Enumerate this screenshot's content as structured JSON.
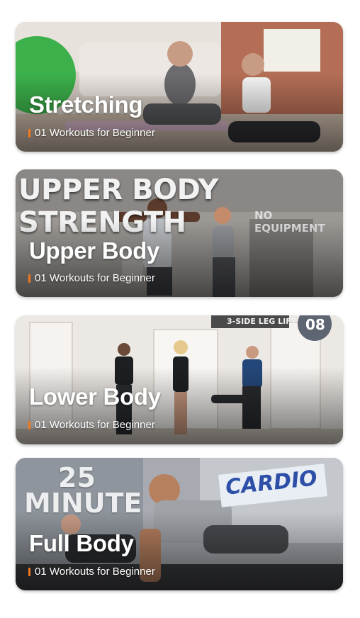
{
  "workouts": [
    {
      "title": "Stretching",
      "subtitle": "01 Workouts for Beginner"
    },
    {
      "title": "Upper Body",
      "subtitle": "01 Workouts for Beginner",
      "banner": "UPPER BODY STRENGTH",
      "tag": "NO EQUIPMENT"
    },
    {
      "title": "Lower Body",
      "subtitle": "01 Workouts for Beginner",
      "banner": "3-SIDE LEG LIFT",
      "number": "08"
    },
    {
      "title": "Full Body",
      "subtitle": "01 Workouts for Beginner",
      "number_text": "25",
      "minute_text": "MINUTE",
      "tag": "CARDIO"
    }
  ],
  "colors": {
    "accent": "#f0781e",
    "title": "#ffffff"
  }
}
